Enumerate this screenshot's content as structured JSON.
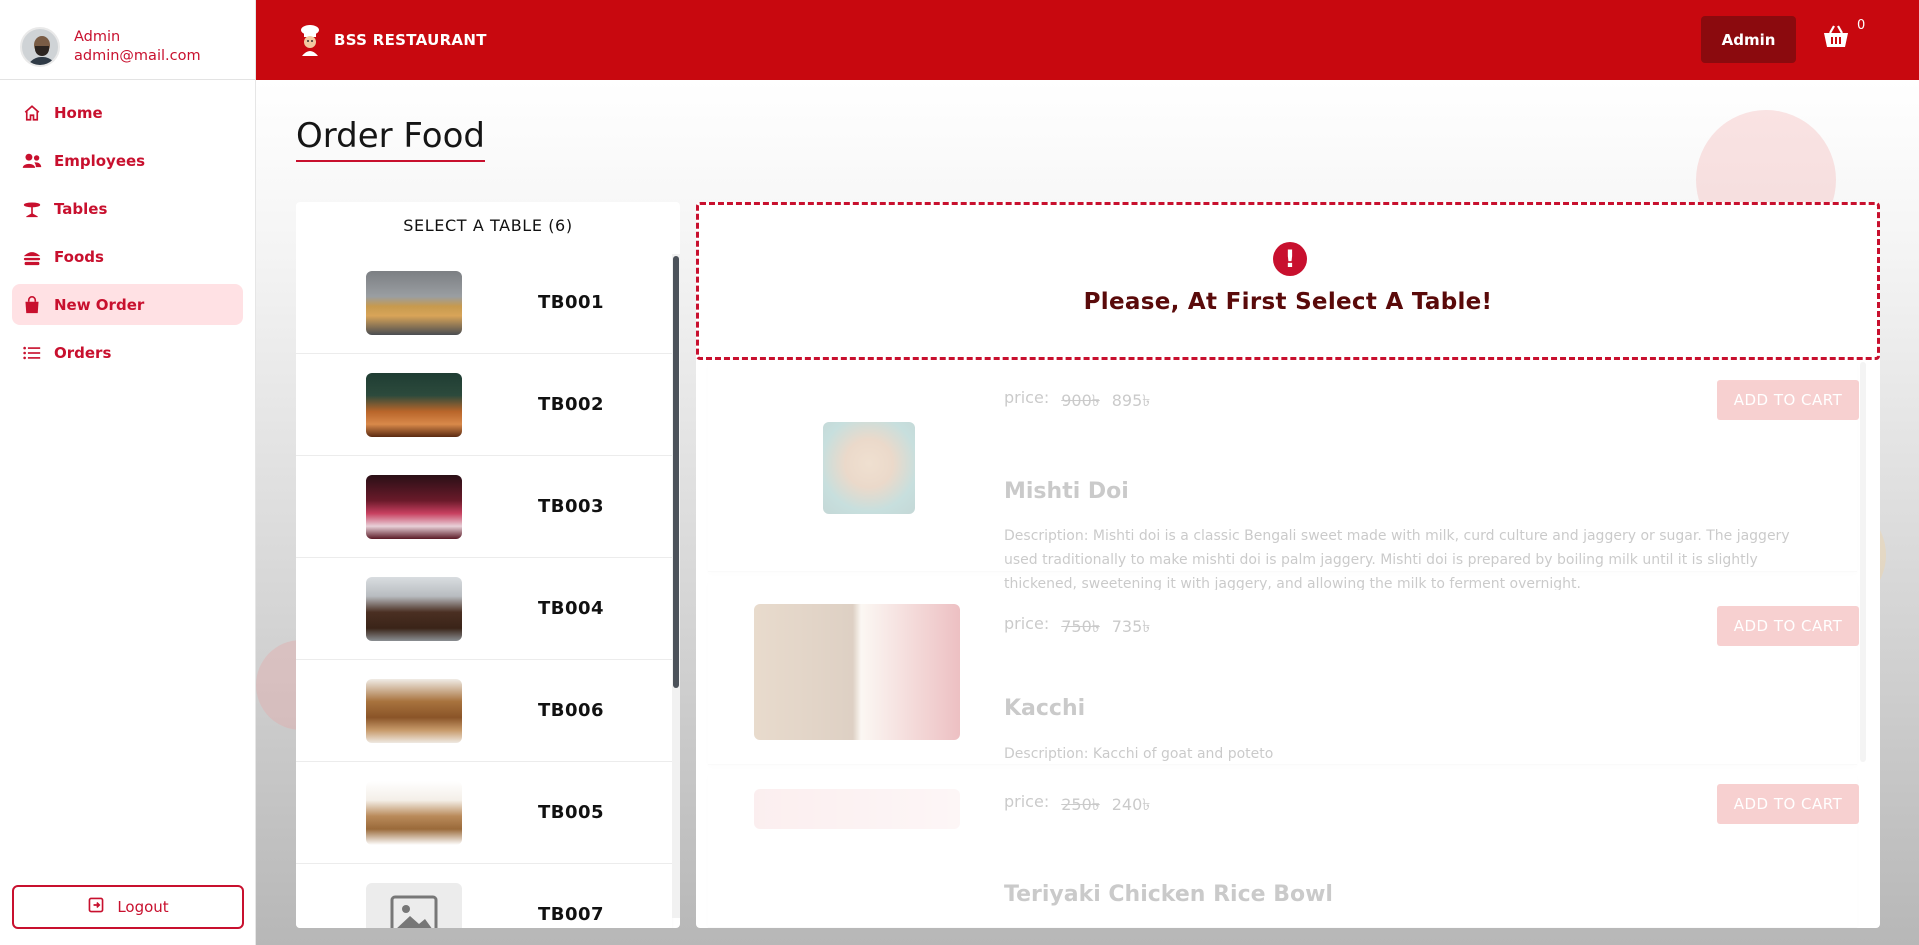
{
  "sidebar": {
    "profile": {
      "name": "Admin",
      "email": "admin@mail.com"
    },
    "items": [
      {
        "label": "Home",
        "icon": "home-icon"
      },
      {
        "label": "Employees",
        "icon": "users-icon"
      },
      {
        "label": "Tables",
        "icon": "table-icon"
      },
      {
        "label": "Foods",
        "icon": "food-icon"
      },
      {
        "label": "New Order",
        "icon": "shopping-bag-icon",
        "active": true
      },
      {
        "label": "Orders",
        "icon": "list-icon"
      }
    ],
    "logout_label": "Logout"
  },
  "header": {
    "brand": "BSS RESTAURANT",
    "admin_label": "Admin",
    "cart_count": "0"
  },
  "page": {
    "title": "Order Food"
  },
  "tables": {
    "title": "SELECT A TABLE (6)",
    "items": [
      {
        "code": "TB001"
      },
      {
        "code": "TB002"
      },
      {
        "code": "TB003"
      },
      {
        "code": "TB004"
      },
      {
        "code": "TB006"
      },
      {
        "code": "TB005"
      },
      {
        "code": "TB007"
      }
    ]
  },
  "alert": {
    "message": "Please, At First Select A Table!"
  },
  "foods": [
    {
      "name": "",
      "description": "",
      "price_label": "price:",
      "old_price": "900৳",
      "price": "895৳",
      "button": "ADD TO CART"
    },
    {
      "name": "Mishti Doi",
      "description": "Description: Mishti doi is a classic Bengali sweet made with milk, curd culture and jaggery or sugar. The jaggery used traditionally to make mishti doi is palm jaggery. Mishti doi is prepared by boiling milk until it is slightly thickened, sweetening it with jaggery, and allowing the milk to ferment overnight.",
      "price_label": "price:",
      "old_price": "750৳",
      "price": "735৳",
      "button": "ADD TO CART"
    },
    {
      "name": "Kacchi",
      "description": "Description: Kacchi of goat and poteto",
      "price_label": "price:",
      "old_price": "250৳",
      "price": "240৳",
      "button": "ADD TO CART"
    },
    {
      "name": "Teriyaki Chicken Rice Bowl",
      "description": "",
      "price_label": "",
      "old_price": "",
      "price": "",
      "button": ""
    }
  ],
  "colors": {
    "primary": "#c8080f",
    "accent_dark": "#8b0a0e",
    "active_bg": "#ffe1e4"
  }
}
